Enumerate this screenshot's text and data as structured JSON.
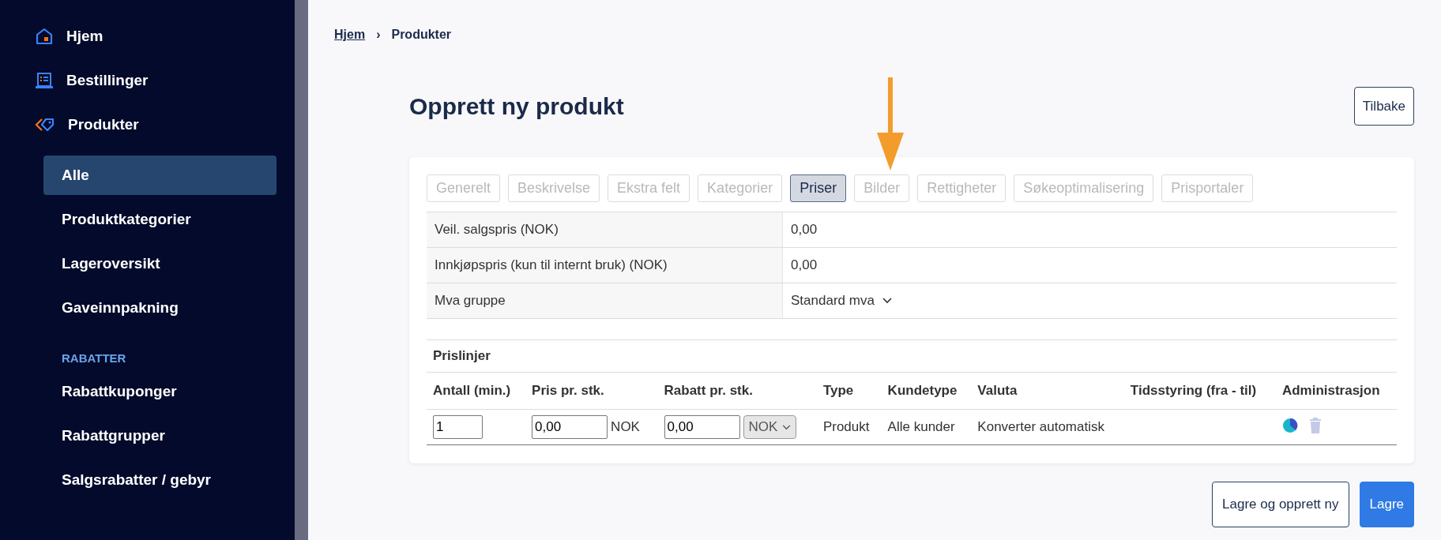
{
  "sidebar": {
    "items": [
      {
        "kind": "main",
        "label": "Hjem"
      },
      {
        "kind": "main",
        "label": "Bestillinger"
      },
      {
        "kind": "main",
        "label": "Produkter"
      },
      {
        "kind": "sub",
        "label": "Alle",
        "selected": true
      },
      {
        "kind": "sub",
        "label": "Produktkategorier",
        "selected": false
      },
      {
        "kind": "sub",
        "label": "Lageroversikt",
        "selected": false
      },
      {
        "kind": "sub",
        "label": "Gaveinnpakning",
        "selected": false
      },
      {
        "kind": "section",
        "label": "RABATTER"
      },
      {
        "kind": "sub",
        "label": "Rabattkuponger",
        "selected": false
      },
      {
        "kind": "sub",
        "label": "Rabattgrupper",
        "selected": false
      },
      {
        "kind": "sub",
        "label": "Salgsrabatter / gebyr",
        "selected": false
      }
    ]
  },
  "breadcrumb": [
    {
      "label": "Hjem",
      "link": true
    },
    {
      "label": "›",
      "link": false
    },
    {
      "label": "Produkter",
      "link": false
    }
  ],
  "page_title": "Opprett ny produkt",
  "back_button": "Tilbake",
  "tabs": [
    {
      "label": "Generelt",
      "selected": false
    },
    {
      "label": "Beskrivelse",
      "selected": false
    },
    {
      "label": "Ekstra felt",
      "selected": false
    },
    {
      "label": "Kategorier",
      "selected": false
    },
    {
      "label": "Priser",
      "selected": true
    },
    {
      "label": "Bilder",
      "selected": false
    },
    {
      "label": "Rettigheter",
      "selected": false
    },
    {
      "label": "Søkeoptimalisering",
      "selected": false
    },
    {
      "label": "Prisportaler",
      "selected": false
    }
  ],
  "fields": [
    {
      "kind": "text",
      "label": "Veil. salgspris (NOK)",
      "value": "0,00"
    },
    {
      "kind": "text",
      "label": "Innkjøpspris (kun til internt bruk) (NOK)",
      "value": "0,00"
    },
    {
      "kind": "select",
      "label": "Mva gruppe",
      "value": "Standard mva"
    }
  ],
  "price_lines": {
    "title": "Prislinjer",
    "columns": [
      "Antall (min.)",
      "Pris pr. stk.",
      "Rabatt pr. stk.",
      "Type",
      "Kundetype",
      "Valuta",
      "Tidsstyring (fra - til)",
      "Administrasjon"
    ],
    "rows": [
      {
        "quantity": "1",
        "price": "0,00",
        "price_currency": "NOK",
        "discount": "0,00",
        "discount_currency": "NOK",
        "type": "Produkt",
        "customer_type": "Alle kunder",
        "currency": "Konverter automatisk"
      }
    ]
  },
  "actions": [
    {
      "label": "Lagre og opprett ny",
      "primary": false
    },
    {
      "label": "Lagre",
      "primary": true
    }
  ]
}
